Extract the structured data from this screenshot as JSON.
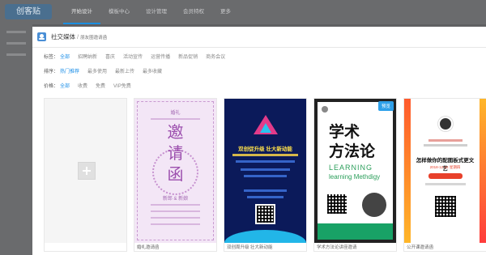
{
  "app": {
    "logo_text": "创客贴",
    "topnav": [
      "开始设计",
      "模板中心",
      "设计管理",
      "会员特权",
      "更多"
    ]
  },
  "modal": {
    "breadcrumb_main": "社交媒体",
    "breadcrumb_sep": "/",
    "breadcrumb_sub": "朋友圈邀请函"
  },
  "filters": {
    "tag": {
      "label": "标签：",
      "options": [
        "全部",
        "招聘纳新",
        "喜庆",
        "活动宣传",
        "运营传播",
        "新品促销",
        "商务会议"
      ],
      "selected_index": 0
    },
    "sort": {
      "label": "排序：",
      "options": [
        "热门推荐",
        "最多使用",
        "最新上传",
        "最多收藏"
      ],
      "selected_index": 0
    },
    "price": {
      "label": "价格：",
      "options": [
        "全部",
        "收费",
        "免费",
        "VIP免费"
      ],
      "selected_index": 0
    }
  },
  "cards": [
    {
      "type": "blank",
      "title": ""
    },
    {
      "type": "invitation",
      "title": "婚礼邀请函",
      "small_top": "婚礼",
      "big_chars": [
        "邀",
        "请",
        "函"
      ],
      "names": "新郎 & 新娘",
      "color": "#9c4fae"
    },
    {
      "type": "tech",
      "title": "双创周升级  壮大新动能",
      "headline": "双创促升级  壮大新动能",
      "color": "#0b1a5a"
    },
    {
      "type": "academic",
      "title": "学术方法论讲座邀请",
      "badge": "预览",
      "big_line1": "学术",
      "big_line2": "方法论",
      "en_line1": "LEARNING",
      "en_line2": "learning Methdigy",
      "color": "#18a266"
    },
    {
      "type": "public-class",
      "title": "公开课邀请函",
      "heading": "怎样做你的配图板式更文艺",
      "date": "2018-12-24 星期四",
      "color": "#e8412b"
    }
  ]
}
